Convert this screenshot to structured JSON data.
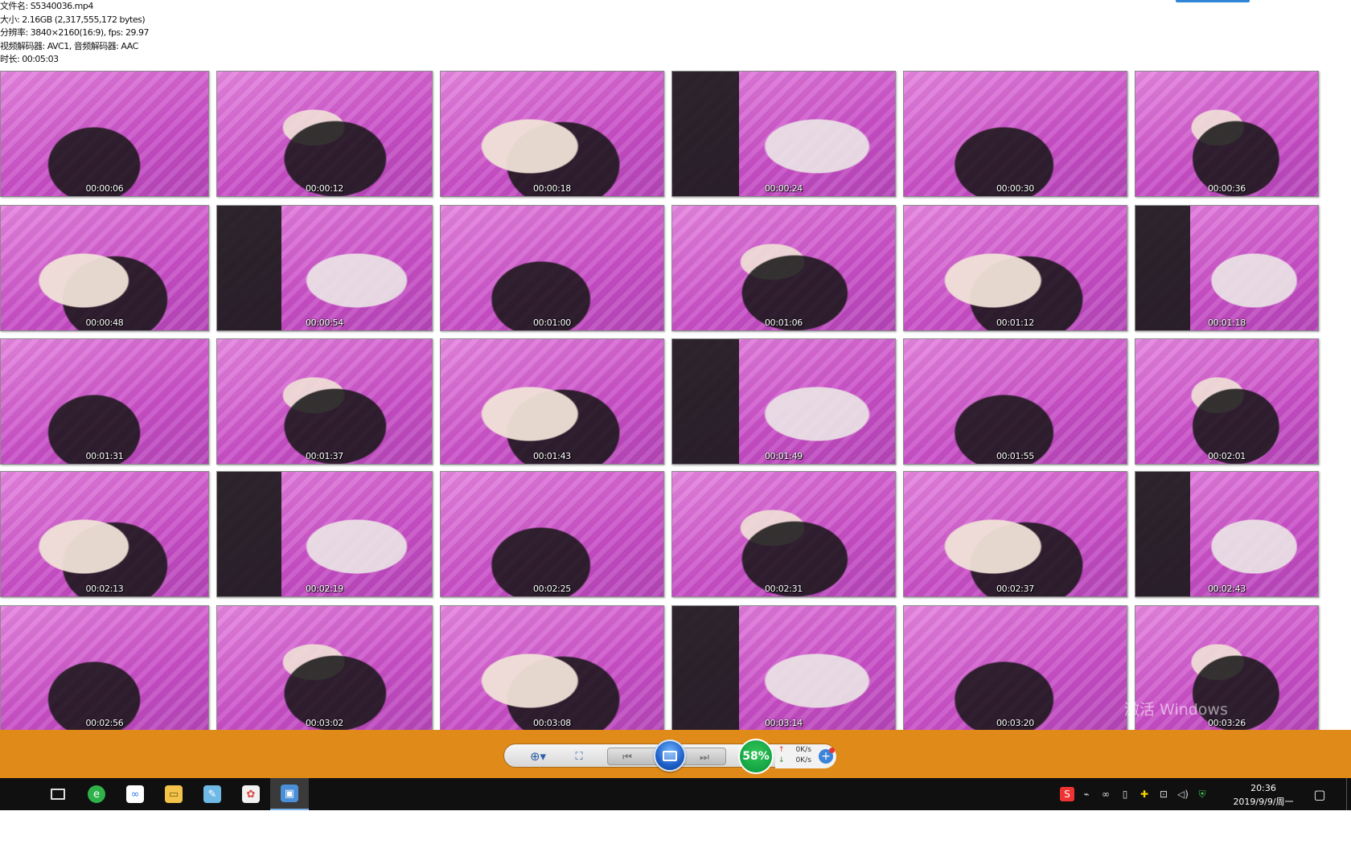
{
  "info": {
    "filename": "文件名: S5340036.mp4",
    "size": "大小: 2.16GB (2,317,555,172 bytes)",
    "resolution": "分辨率: 3840×2160(16:9), fps: 29.97",
    "codecs": "视频解码器: AVC1, 音频解码器: AAC",
    "duration": "时长: 00:05:03"
  },
  "thumbnails": [
    "00:00:06",
    "00:00:12",
    "00:00:18",
    "00:00:24",
    "00:00:30",
    "00:00:36",
    "00:00:48",
    "00:00:54",
    "00:01:00",
    "00:01:06",
    "00:01:12",
    "00:01:18",
    "00:01:31",
    "00:01:37",
    "00:01:43",
    "00:01:49",
    "00:01:55",
    "00:02:01",
    "00:02:13",
    "00:02:19",
    "00:02:25",
    "00:02:31",
    "00:02:37",
    "00:02:43",
    "00:02:56",
    "00:03:02",
    "00:03:08",
    "00:03:14",
    "00:03:20",
    "00:03:26"
  ],
  "toolbar": {
    "zoom_icon": "zoom-in-icon",
    "fit_icon": "fit-screen-icon",
    "prev_icon": "previous-icon",
    "next_icon": "next-icon",
    "slideshow_icon": "slideshow-icon",
    "cpu_percent": "58%",
    "net_up": "0K/s",
    "net_down": "0K/s",
    "accent_color": "#e08a19"
  },
  "watermark": "激活 Windows",
  "taskbar": {
    "apps": [
      "windows-start-icon",
      "task-view-icon",
      "browser-360-icon",
      "baidu-netdisk-icon",
      "file-explorer-icon",
      "notepad-icon",
      "paint-icon",
      "photo-viewer-icon"
    ],
    "time": "20:36",
    "date": "2019/9/9/周一"
  }
}
